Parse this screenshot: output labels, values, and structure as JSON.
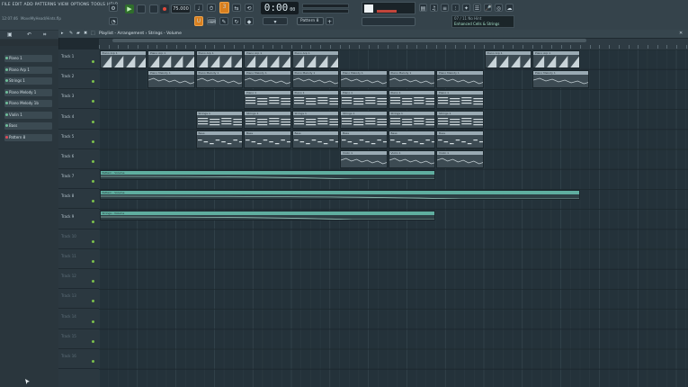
{
  "window": {
    "menu": [
      "FILE",
      "EDIT",
      "ADD",
      "PATTERNS",
      "VIEW",
      "OPTIONS",
      "TOOLS",
      "HELP"
    ],
    "hint_left": [
      "12:07:46",
      "MoveMyHead/Hints.flp"
    ],
    "bpm": "75.000",
    "time": "0:00",
    "time_sub": "00",
    "pattern": "Pattern 8",
    "hint_panel_line1": "07 / 11  No Hint",
    "hint_panel_line2": "Enhanced Cells & Strings"
  },
  "browser": {
    "items": [
      {
        "label": "Piano 1",
        "dot": "green"
      },
      {
        "label": "Piano Arp 1",
        "dot": "green"
      },
      {
        "label": "Strings 1",
        "dot": "green"
      },
      {
        "label": "Piano Melody 1",
        "dot": "green"
      },
      {
        "label": "Piano Melody 1b",
        "dot": "green"
      },
      {
        "label": "Violin 1",
        "dot": "green"
      },
      {
        "label": "Bass",
        "dot": "green"
      },
      {
        "label": "Pattern 8",
        "dot": "red"
      }
    ]
  },
  "playlist": {
    "title": "Playlist - Arrangement › Strings - Volume",
    "tracks": [
      "Track 1",
      "Track 2",
      "Track 3",
      "Track 4",
      "Track 5",
      "Track 6",
      "Track 7",
      "Track 8",
      "Track 9",
      "Track 10",
      "Track 11",
      "Track 12",
      "Track 13",
      "Track 14",
      "Track 15",
      "Track 16"
    ],
    "clips": [
      {
        "row": 0,
        "start": 0,
        "len": 5,
        "label": "Piano Arp 1",
        "kind": "arp"
      },
      {
        "row": 0,
        "start": 5,
        "len": 5,
        "label": "Piano Arp 1",
        "kind": "arp"
      },
      {
        "row": 0,
        "start": 10,
        "len": 5,
        "label": "Piano Arp 1",
        "kind": "arp"
      },
      {
        "row": 0,
        "start": 15,
        "len": 5,
        "label": "Piano Arp 1",
        "kind": "arp"
      },
      {
        "row": 0,
        "start": 20,
        "len": 5,
        "label": "Piano Arp 1",
        "kind": "arp"
      },
      {
        "row": 0,
        "start": 40,
        "len": 5,
        "label": "Piano Arp 1",
        "kind": "arp"
      },
      {
        "row": 0,
        "start": 45,
        "len": 5,
        "label": "Piano Arp 1",
        "kind": "arp"
      },
      {
        "row": 1,
        "start": 5,
        "len": 5,
        "label": "Piano Melody 1",
        "kind": "mel"
      },
      {
        "row": 1,
        "start": 10,
        "len": 5,
        "label": "Piano Melody 1",
        "kind": "mel"
      },
      {
        "row": 1,
        "start": 15,
        "len": 5,
        "label": "Piano Melody 1",
        "kind": "mel"
      },
      {
        "row": 1,
        "start": 20,
        "len": 5,
        "label": "Piano Melody 1",
        "kind": "mel"
      },
      {
        "row": 1,
        "start": 25,
        "len": 5,
        "label": "Piano Melody 1",
        "kind": "mel"
      },
      {
        "row": 1,
        "start": 30,
        "len": 5,
        "label": "Piano Melody 1",
        "kind": "mel"
      },
      {
        "row": 1,
        "start": 35,
        "len": 5,
        "label": "Piano Melody 1",
        "kind": "mel"
      },
      {
        "row": 1,
        "start": 45,
        "len": 6,
        "label": "Piano Melody 1",
        "kind": "mel"
      },
      {
        "row": 2,
        "start": 15,
        "len": 5,
        "label": "Piano 1",
        "kind": "chord"
      },
      {
        "row": 2,
        "start": 20,
        "len": 5,
        "label": "Piano 1",
        "kind": "chord"
      },
      {
        "row": 2,
        "start": 25,
        "len": 5,
        "label": "Piano 1",
        "kind": "chord"
      },
      {
        "row": 2,
        "start": 30,
        "len": 5,
        "label": "Piano 1",
        "kind": "chord"
      },
      {
        "row": 2,
        "start": 35,
        "len": 5,
        "label": "Piano 1",
        "kind": "chord"
      },
      {
        "row": 3,
        "start": 10,
        "len": 5,
        "label": "Strings 1",
        "kind": "chord"
      },
      {
        "row": 3,
        "start": 15,
        "len": 5,
        "label": "Strings 1",
        "kind": "chord"
      },
      {
        "row": 3,
        "start": 20,
        "len": 5,
        "label": "Strings 1",
        "kind": "chord"
      },
      {
        "row": 3,
        "start": 25,
        "len": 5,
        "label": "Strings 1",
        "kind": "chord"
      },
      {
        "row": 3,
        "start": 30,
        "len": 5,
        "label": "Strings 1",
        "kind": "chord"
      },
      {
        "row": 3,
        "start": 35,
        "len": 5,
        "label": "Strings 1",
        "kind": "chord"
      },
      {
        "row": 4,
        "start": 10,
        "len": 5,
        "label": "Bass",
        "kind": "bass"
      },
      {
        "row": 4,
        "start": 15,
        "len": 5,
        "label": "Bass",
        "kind": "bass"
      },
      {
        "row": 4,
        "start": 20,
        "len": 5,
        "label": "Bass",
        "kind": "bass"
      },
      {
        "row": 4,
        "start": 25,
        "len": 5,
        "label": "Bass",
        "kind": "bass"
      },
      {
        "row": 4,
        "start": 30,
        "len": 5,
        "label": "Bass",
        "kind": "bass"
      },
      {
        "row": 4,
        "start": 35,
        "len": 5,
        "label": "Bass",
        "kind": "bass"
      },
      {
        "row": 5,
        "start": 25,
        "len": 5,
        "label": "Violin 1",
        "kind": "mel"
      },
      {
        "row": 5,
        "start": 30,
        "len": 5,
        "label": "Violin 1",
        "kind": "mel"
      },
      {
        "row": 5,
        "start": 35,
        "len": 5,
        "label": "Violin 1",
        "kind": "mel"
      },
      {
        "row": 6,
        "start": 0,
        "len": 35,
        "label": "Pattern - Volume",
        "kind": "auto"
      },
      {
        "row": 7,
        "start": 0,
        "len": 50,
        "label": "Pattern - Volume",
        "kind": "auto"
      },
      {
        "row": 8,
        "start": 0,
        "len": 35,
        "label": "Strings - Volume",
        "kind": "auto"
      }
    ]
  },
  "colors": {
    "clip_header": "#9aaab3",
    "clip_body": "#3d4b53",
    "auto_header": "#5fae9f",
    "auto_body": "#2d3f44",
    "accent_green": "#7cc04c",
    "orange": "#d87f1e"
  }
}
